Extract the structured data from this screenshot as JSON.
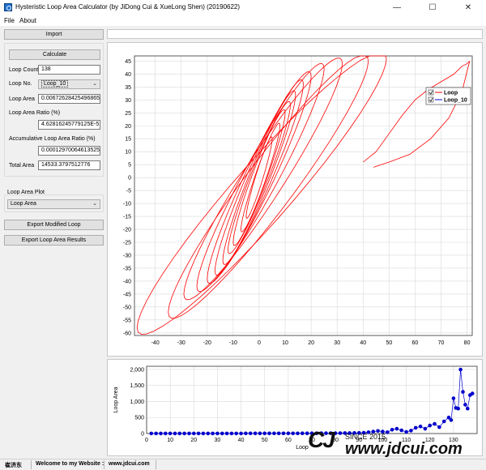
{
  "window": {
    "title": "Hysteristic Loop Area Calculator (by JiDong Cui & XueLong Shen) (20190622)",
    "min_glyph": "—",
    "max_glyph": "☐",
    "close_glyph": "✕"
  },
  "menu": [
    "File",
    "About"
  ],
  "left": {
    "import_label": "Import",
    "calculate_label": "Calculate",
    "loop_count_label": "Loop Count",
    "loop_count_value": "138",
    "loop_no_label": "Loop No.",
    "loop_no_value": "Loop_10",
    "loop_area_label": "Loop Area",
    "loop_area_value": "0.00672628425496865",
    "loop_area_ratio_label": "Loop Area Ratio (%)",
    "loop_area_ratio_value": "4.62816245779125E-5",
    "acc_ratio_label": "Accumulative Loop Area Ratio (%)",
    "acc_ratio_value": "0.000129700646135251",
    "total_area_label": "Total Area",
    "total_area_value": "14533.3797512776",
    "plot_label": "Loop Area Plot",
    "plot_value": "Loop Area",
    "export_modified_label": "Export Modified Loop",
    "export_results_label": "Export Loop Area Results"
  },
  "status": {
    "author": "崔济东",
    "website_label": "Welcome to my Website :",
    "website_url": "www.jdcui.com"
  },
  "watermark": {
    "logo": "CJ",
    "since": "SINCE 2015",
    "url": "www.jdcui.com"
  },
  "chart_data": [
    {
      "type": "line",
      "title": "",
      "xlabel": "",
      "ylabel": "",
      "xlim": [
        -48,
        82
      ],
      "ylim": [
        -61,
        47
      ],
      "x_ticks": [
        -40,
        -30,
        -20,
        -10,
        0,
        10,
        20,
        30,
        40,
        50,
        60,
        70,
        80
      ],
      "y_ticks": [
        45,
        40,
        35,
        30,
        25,
        20,
        15,
        10,
        5,
        0,
        -5,
        -10,
        -15,
        -20,
        -25,
        -30,
        -35,
        -40,
        -45,
        -50,
        -55,
        -60
      ],
      "grid": true,
      "legend": "top-right",
      "series": [
        {
          "name": "Loop",
          "color": "#ff0000",
          "loops": [
            {
              "xmin": -5,
              "xmax": 5,
              "ymin": -15,
              "ymax": 15
            },
            {
              "xmin": -7,
              "xmax": 8,
              "ymin": -20,
              "ymax": 20
            },
            {
              "xmin": -10,
              "xmax": 10,
              "ymin": -25,
              "ymax": 25
            },
            {
              "xmin": -12,
              "xmax": 12,
              "ymin": -28,
              "ymax": 28
            },
            {
              "xmin": -14,
              "xmax": 14,
              "ymin": -32,
              "ymax": 32
            },
            {
              "xmin": -17,
              "xmax": 17,
              "ymin": -36,
              "ymax": 36
            },
            {
              "xmin": -20,
              "xmax": 20,
              "ymin": -39,
              "ymax": 39
            },
            {
              "xmin": -24,
              "xmax": 25,
              "ymin": -42,
              "ymax": 42
            },
            {
              "xmin": -29,
              "xmax": 32,
              "ymin": -45,
              "ymax": 44
            },
            {
              "xmin": -35,
              "xmax": 42,
              "ymin": -52,
              "ymax": 45
            },
            {
              "xmin": -47,
              "xmax": 49,
              "ymin": -58,
              "ymax": 46
            }
          ],
          "tail_x": [
            40,
            45,
            50,
            55,
            60,
            65,
            70,
            75,
            78,
            80,
            81
          ],
          "tail_y": [
            6,
            10,
            17,
            24,
            30,
            34,
            37,
            40,
            43,
            44,
            45
          ],
          "return_x": [
            81,
            78,
            73,
            66,
            58,
            50,
            44
          ],
          "return_y": [
            45,
            33,
            23,
            15,
            9,
            6,
            4
          ]
        },
        {
          "name": "Loop_10",
          "color": "#0000cc",
          "x": [],
          "y": []
        }
      ]
    },
    {
      "type": "line",
      "title": "",
      "xlabel": "Loop",
      "ylabel": "Loop Area",
      "xlim": [
        0,
        140
      ],
      "ylim": [
        0,
        2100
      ],
      "x_ticks": [
        0,
        10,
        20,
        30,
        40,
        50,
        60,
        70,
        80,
        90,
        100,
        110,
        120,
        130
      ],
      "y_ticks": [
        0,
        500,
        1000,
        1500,
        2000
      ],
      "y_tick_labels": [
        "0",
        "500",
        "1,000",
        "1,500",
        "2,000"
      ],
      "grid": true,
      "series": [
        {
          "name": "Loop Area",
          "color": "#0000cc",
          "x": [
            2,
            4,
            6,
            8,
            10,
            12,
            14,
            16,
            18,
            20,
            22,
            24,
            26,
            28,
            30,
            32,
            34,
            36,
            38,
            40,
            42,
            44,
            46,
            48,
            50,
            52,
            54,
            56,
            58,
            60,
            62,
            64,
            66,
            68,
            70,
            72,
            74,
            76,
            78,
            80,
            82,
            84,
            86,
            88,
            90,
            92,
            94,
            96,
            98,
            100,
            102,
            104,
            106,
            108,
            110,
            112,
            114,
            116,
            118,
            120,
            122,
            124,
            126,
            128,
            129,
            130,
            131,
            132,
            133,
            134,
            135,
            136,
            137,
            138
          ],
          "y": [
            2,
            2,
            2,
            2,
            2,
            2,
            2,
            2,
            2,
            2,
            2,
            2,
            2,
            3,
            3,
            3,
            3,
            3,
            3,
            3,
            4,
            4,
            4,
            4,
            4,
            5,
            5,
            5,
            5,
            6,
            6,
            6,
            7,
            7,
            8,
            8,
            9,
            9,
            10,
            10,
            12,
            14,
            16,
            18,
            20,
            25,
            40,
            60,
            80,
            60,
            40,
            120,
            150,
            100,
            50,
            90,
            180,
            220,
            150,
            250,
            300,
            200,
            380,
            500,
            420,
            1100,
            800,
            780,
            2000,
            1300,
            900,
            780,
            1200,
            1250
          ]
        }
      ]
    }
  ]
}
